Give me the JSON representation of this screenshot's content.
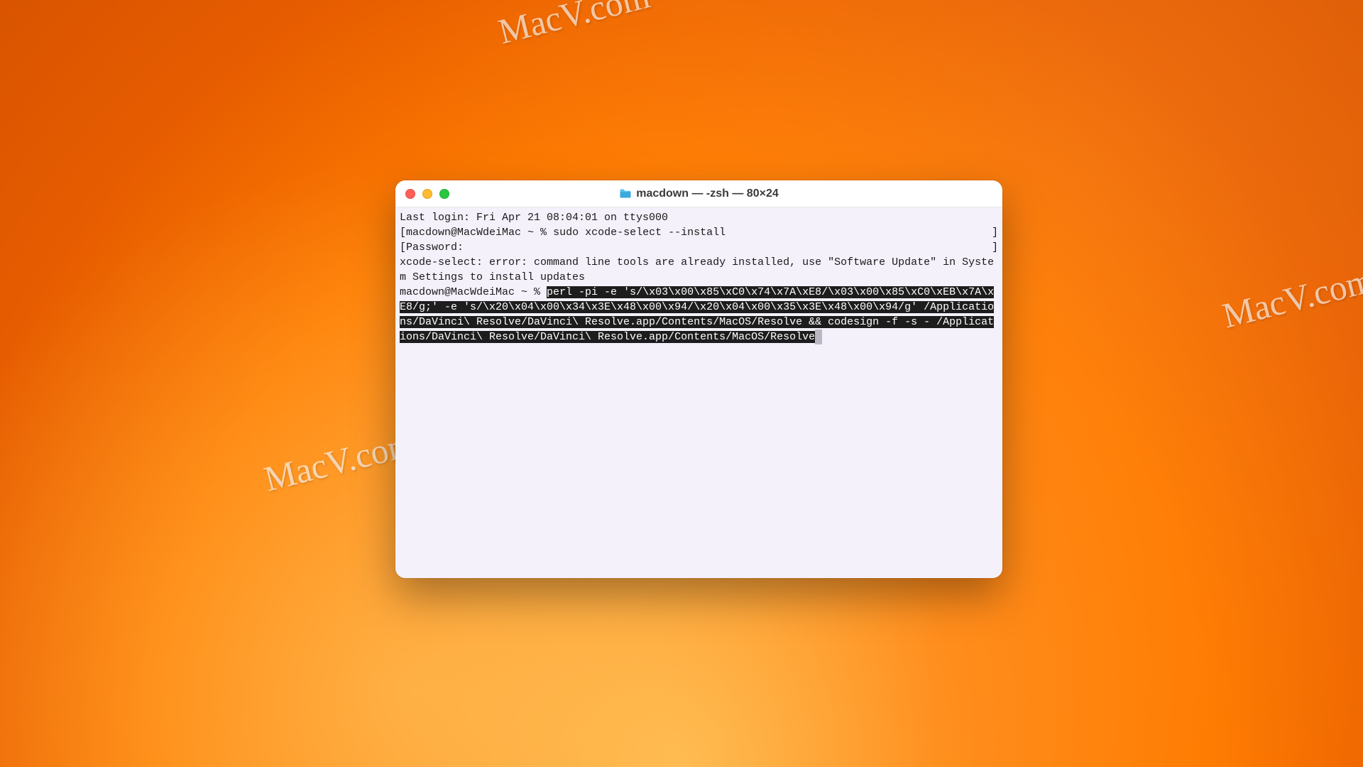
{
  "watermark_text": "MacV.com",
  "window": {
    "title": "macdown — -zsh — 80×24"
  },
  "terminal": {
    "line1": "Last login: Fri Apr 21 08:04:01 on ttys000",
    "line2_open": "[",
    "line2_prompt": "macdown@MacWdeiMac ~ % ",
    "line2_cmd": "sudo xcode-select --install",
    "line2_close": "]",
    "line3_open": "[",
    "line3_text": "Password:",
    "line3_close": "]",
    "line4": "xcode-select: error: command line tools are already installed, use \"Software Update\" in System Settings to install updates",
    "line5_prompt": "macdown@MacWdeiMac ~ % ",
    "selected_cmd": "perl -pi -e 's/\\x03\\x00\\x85\\xC0\\x74\\x7A\\xE8/\\x03\\x00\\x85\\xC0\\xEB\\x7A\\xE8/g;' -e 's/\\x20\\x04\\x00\\x34\\x3E\\x48\\x00\\x94/\\x20\\x04\\x00\\x35\\x3E\\x48\\x00\\x94/g' /Applications/DaVinci\\ Resolve/DaVinci\\ Resolve.app/Contents/MacOS/Resolve && codesign -f -s - /Applications/DaVinci\\ Resolve/DaVinci\\ Resolve.app/Contents/MacOS/Resolve"
  }
}
